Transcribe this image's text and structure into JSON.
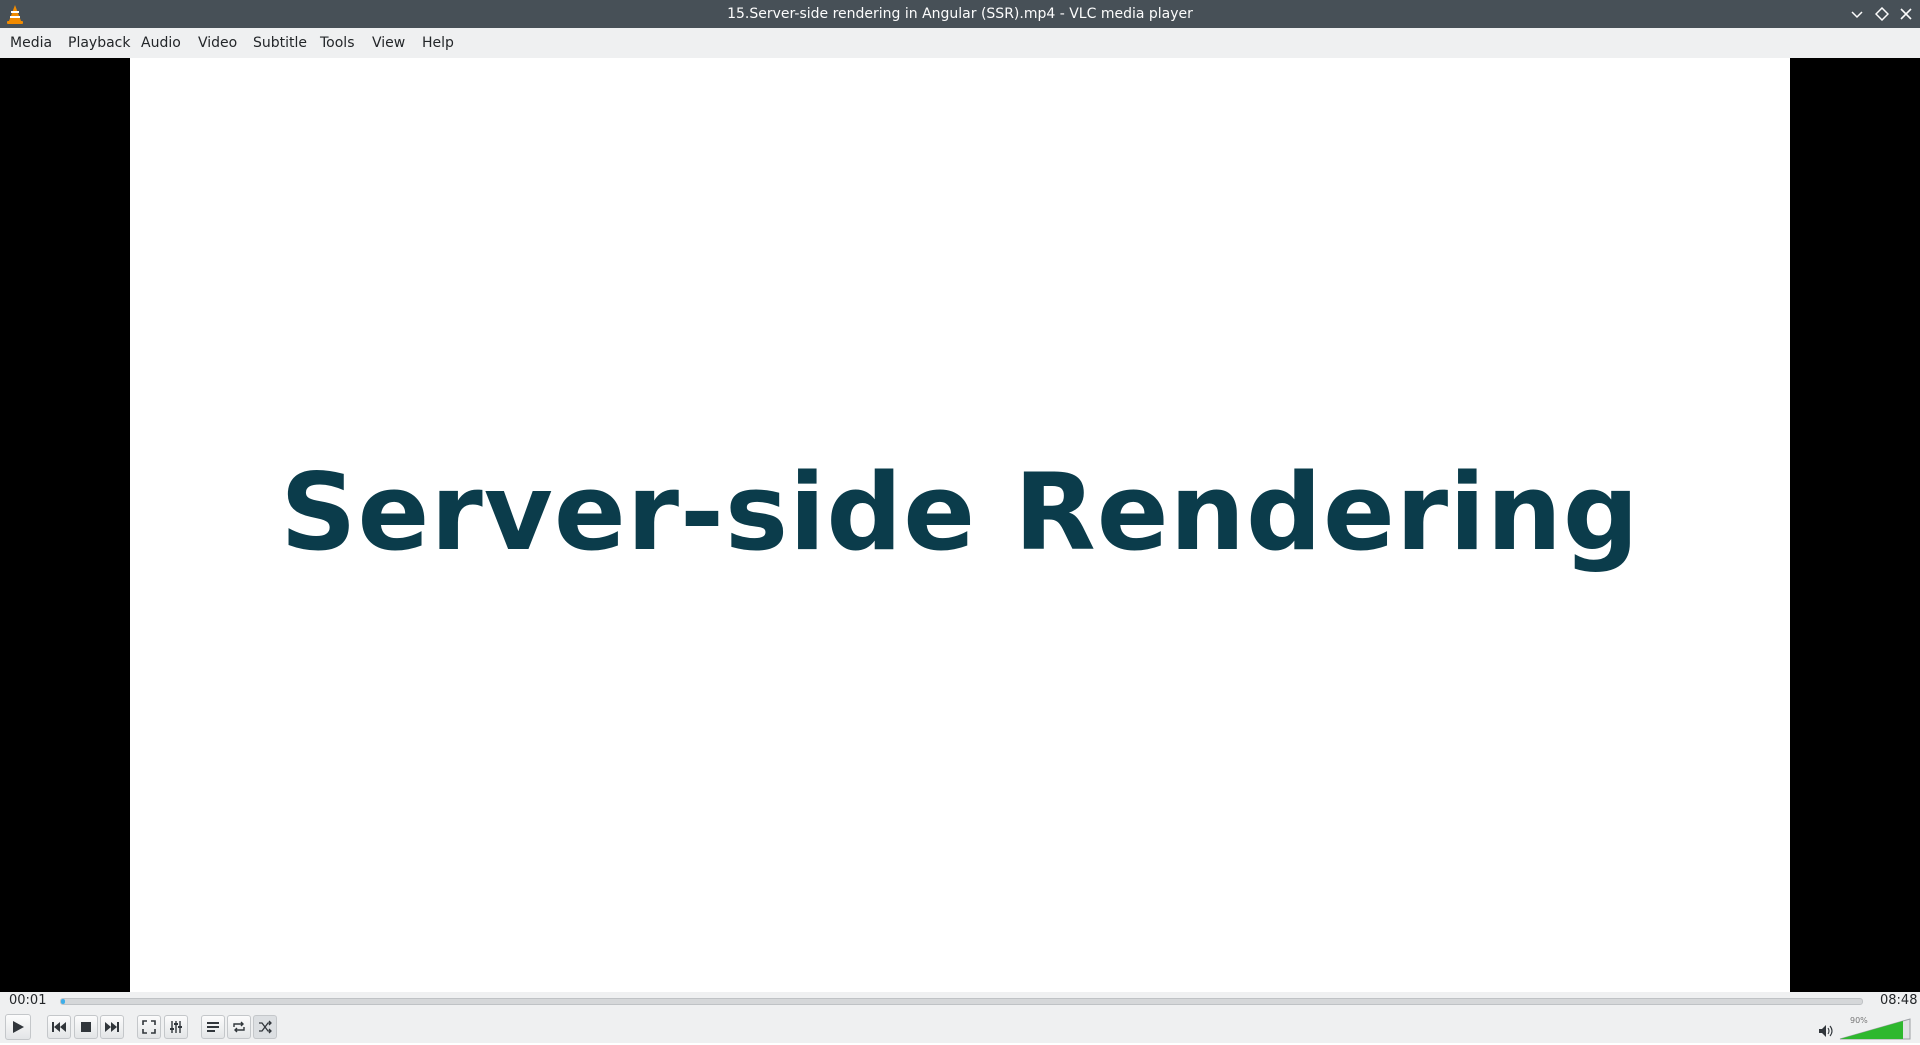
{
  "window": {
    "title": "15.Server-side rendering in Angular (SSR).mp4 - VLC media player",
    "app_icon": "vlc-cone-icon",
    "buttons": [
      "minimize-icon",
      "maximize-icon",
      "close-icon"
    ]
  },
  "menubar": {
    "items": [
      {
        "label": "Media"
      },
      {
        "label": "Playback"
      },
      {
        "label": "Audio"
      },
      {
        "label": "Video"
      },
      {
        "label": "Subtitle"
      },
      {
        "label": "Tools"
      },
      {
        "label": "View"
      },
      {
        "label": "Help"
      }
    ]
  },
  "video": {
    "slide_text": "Server-side Rendering",
    "slide_text_color": "#0b3c4b"
  },
  "playback": {
    "elapsed": "00:01",
    "total": "08:48",
    "progress_fraction": 0.002
  },
  "controls": {
    "buttons": [
      "play-icon",
      "previous-icon",
      "stop-icon",
      "next-icon",
      "fullscreen-icon",
      "extended-settings-icon",
      "playlist-icon",
      "loop-icon",
      "shuffle-icon"
    ]
  },
  "volume": {
    "percent_label": "90%",
    "level_fraction": 0.9,
    "icon": "speaker-icon"
  },
  "colors": {
    "titlebar": "#475057",
    "accent": "#3daee9",
    "volume_fill": "#2eb82e"
  }
}
